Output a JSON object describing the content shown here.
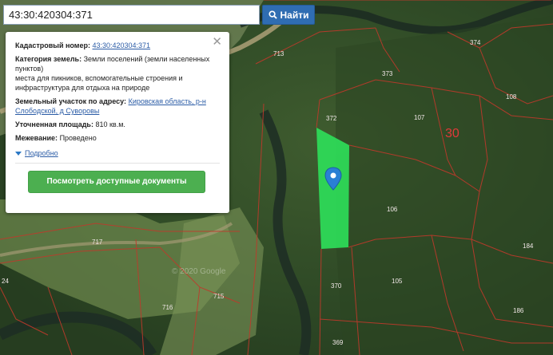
{
  "search": {
    "value": "43:30:420304:371",
    "button_label": "Найти",
    "button_icon": "search-icon"
  },
  "popup": {
    "close_icon": "close-icon",
    "cadastral_label": "Кадастровый номер:",
    "cadastral_value": "43:30:420304:371",
    "category_label": "Категория земель:",
    "category_value": "Земли поселений (земли населенных пунктов)",
    "category_extra": "места для пикников, вспомогательные строения и инфраструктура для отдыха на природе",
    "address_label": "Земельный участок по адресу:",
    "address_value": "Кировская область, р-н Слободской, д Суворовы",
    "area_label": "Уточненная площадь:",
    "area_value": "810 кв.м.",
    "boundary_label": "Межевание:",
    "boundary_value": "Проведено",
    "more_label": "Подробно",
    "docs_button": "Посмотреть доступные документы"
  },
  "map": {
    "plot_labels": [
      "713",
      "374",
      "373",
      "108",
      "107",
      "372",
      "106",
      "184",
      "105",
      "370",
      "186",
      "369",
      "717",
      "716",
      "715",
      "24"
    ],
    "quarter_label": "30",
    "watermark": "© 2020 Google",
    "highlight_color": "#2ee05a",
    "boundary_color": "#c0392b",
    "marker_color": "#2a7fd4"
  }
}
